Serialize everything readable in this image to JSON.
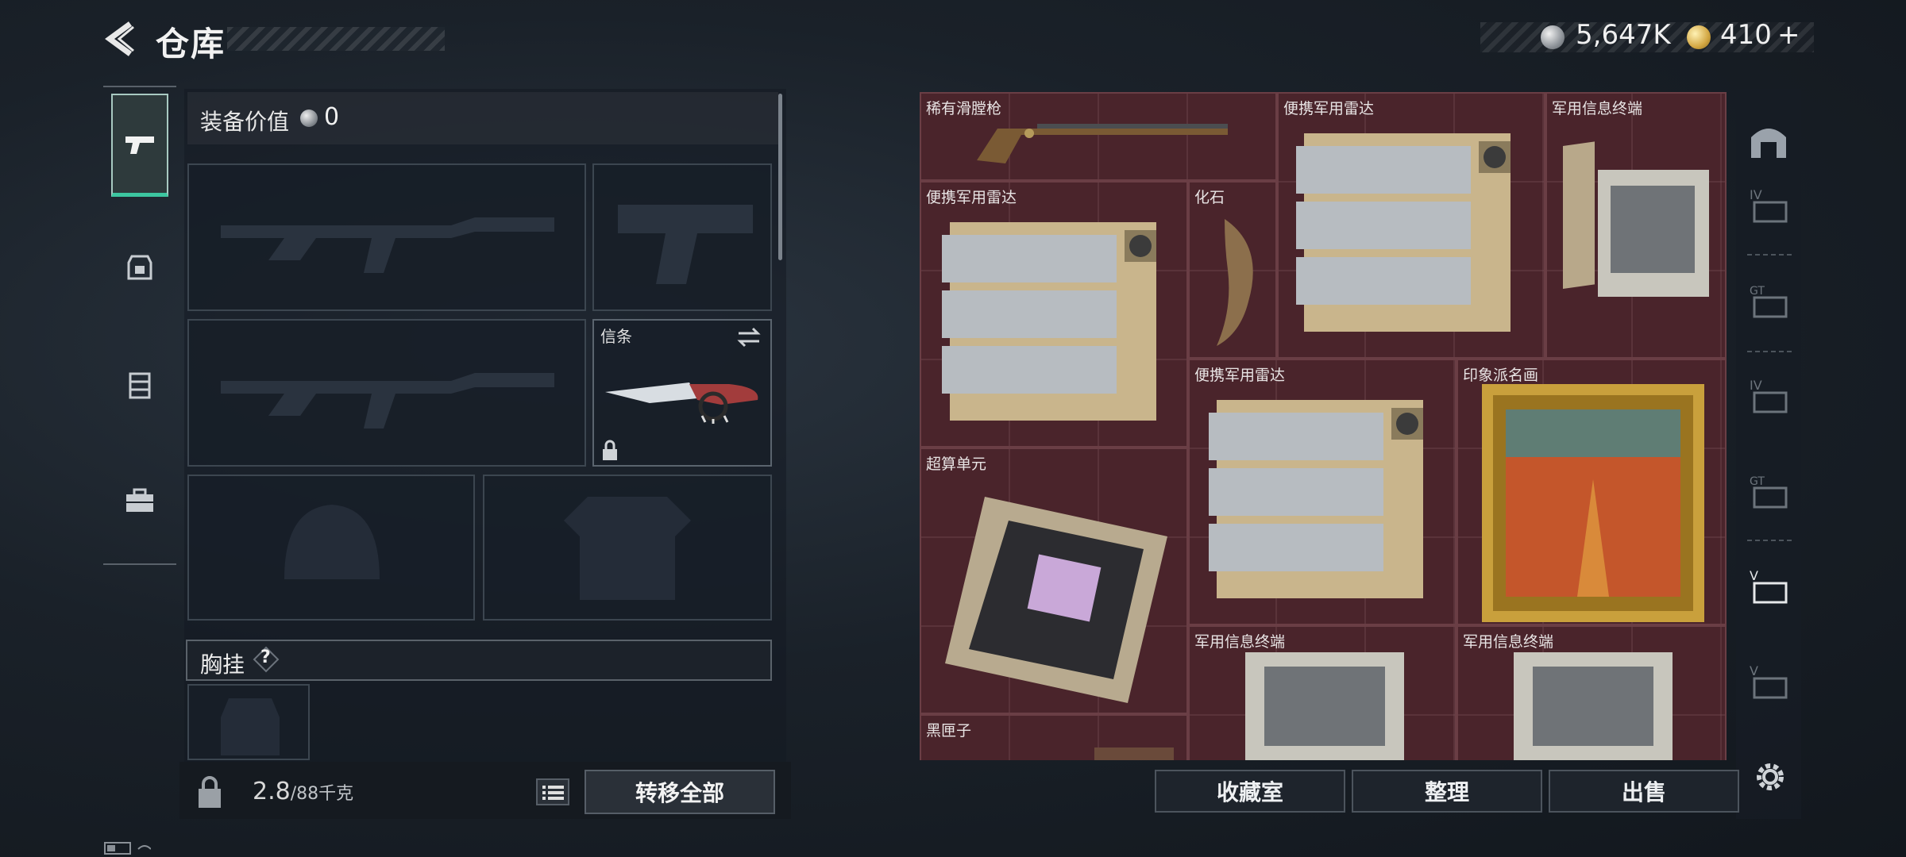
{
  "header": {
    "title": "仓库",
    "silver_amount": "5,647K",
    "gold_amount": "410",
    "gold_plus": "+"
  },
  "equipment": {
    "title": "装备价值",
    "value": "0",
    "melee_slot_label": "信条",
    "chest_label": "胸挂",
    "chest_help": "?",
    "weight_current": "2.8",
    "weight_max": "/88千克",
    "transfer_all": "转移全部"
  },
  "storage": {
    "items": [
      {
        "label": "稀有滑膛枪"
      },
      {
        "label": "便携军用雷达"
      },
      {
        "label": "军用信息终端"
      },
      {
        "label": "便携军用雷达"
      },
      {
        "label": "化石"
      },
      {
        "label": "便携军用雷达"
      },
      {
        "label": "印象派名画"
      },
      {
        "label": "超算单元"
      },
      {
        "label": "军用信息终端"
      },
      {
        "label": "军用信息终端"
      },
      {
        "label": "黑匣子"
      }
    ]
  },
  "actions": {
    "collection": "收藏室",
    "sort": "整理",
    "sell": "出售"
  },
  "colors": {
    "storage_bg": "#4a242b",
    "active_tab_accent": "#3cc6a0"
  }
}
